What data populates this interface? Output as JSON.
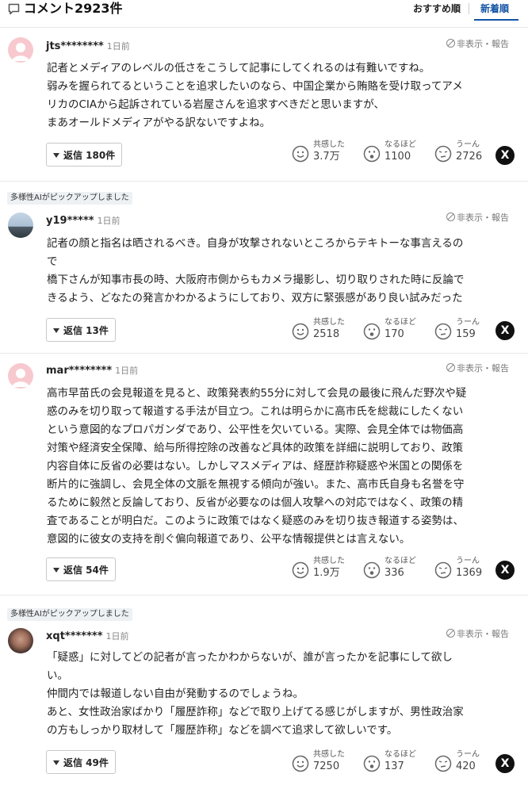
{
  "header": {
    "title": "コメント2923件",
    "sort_recommended": "おすすめ順",
    "sort_newest": "新着順"
  },
  "labels": {
    "hide_report": "非表示・報告",
    "react_agree": "共感した",
    "react_indeed": "なるほど",
    "react_hmm": "うーん",
    "share_x": "X",
    "ai_pick": "多様性AIがピックアップしました"
  },
  "comments": [
    {
      "user": "jts********",
      "time": "1日前",
      "lines": [
        "記者とメディアのレベルの低さをこうして記事にしてくれるのは有難いですね。",
        "弱みを握られてるということを追求したいのなら、中国企業から賄賂を受け取ってアメ",
        "リカのCIAから起訴されている岩屋さんを追求すべきだと思いますが、",
        "まあオールドメディアがやる訳ないですよね。"
      ],
      "replies": "返信 180件",
      "agree": "3.7万",
      "indeed": "1100",
      "hmm": "2726"
    },
    {
      "user": "y19*****",
      "time": "1日前",
      "lines": [
        "記者の顔と指名は晒されるべき。自身が攻撃されないところからテキトーな事言えるの",
        "で",
        "橋下さんが知事市長の時、大阪府市側からもカメラ撮影し、切り取りされた時に反論で",
        "きるよう、どなたの発言かわかるようにしており、双方に緊張感があり良い試みだった"
      ],
      "replies": "返信 13件",
      "agree": "2518",
      "indeed": "170",
      "hmm": "159"
    },
    {
      "user": "mar********",
      "time": "1日前",
      "lines": [
        "高市早苗氏の会見報道を見ると、政策発表約55分に対して会見の最後に飛んだ野次や疑",
        "惑のみを切り取って報道する手法が目立つ。これは明らかに高市氏を総裁にしたくない",
        "という意図的なプロパガンダであり、公平性を欠いている。実際、会見全体では物価高",
        "対策や経済安全保障、給与所得控除の改善など具体的政策を詳細に説明しており、政策",
        "内容自体に反省の必要はない。しかしマスメディアは、経歴詐称疑惑や米国との関係を",
        "断片的に強調し、会見全体の文脈を無視する傾向が強い。また、高市氏自身も名誉を守",
        "るために毅然と反論しており、反省が必要なのは個人攻撃への対応ではなく、政策の精",
        "査であることが明白だ。このように政策ではなく疑惑のみを切り抜き報道する姿勢は、",
        "意図的に彼女の支持を削ぐ偏向報道であり、公平な情報提供とは言えない。"
      ],
      "replies": "返信 54件",
      "agree": "1.9万",
      "indeed": "336",
      "hmm": "1369"
    },
    {
      "user": "xqt*******",
      "time": "1日前",
      "lines": [
        "「疑惑」に対してどの記者が言ったかわからないが、誰が言ったかを記事にして欲し",
        "い。",
        "仲間内では報道しない自由が発動するのでしょうね。",
        "あと、女性政治家ばかり「履歴詐称」などで取り上げてる感じがしますが、男性政治家",
        "の方もしっかり取材して「履歴詐称」などを調べて追求して欲しいです。"
      ],
      "replies": "返信 49件",
      "agree": "7250",
      "indeed": "137",
      "hmm": "420"
    }
  ]
}
